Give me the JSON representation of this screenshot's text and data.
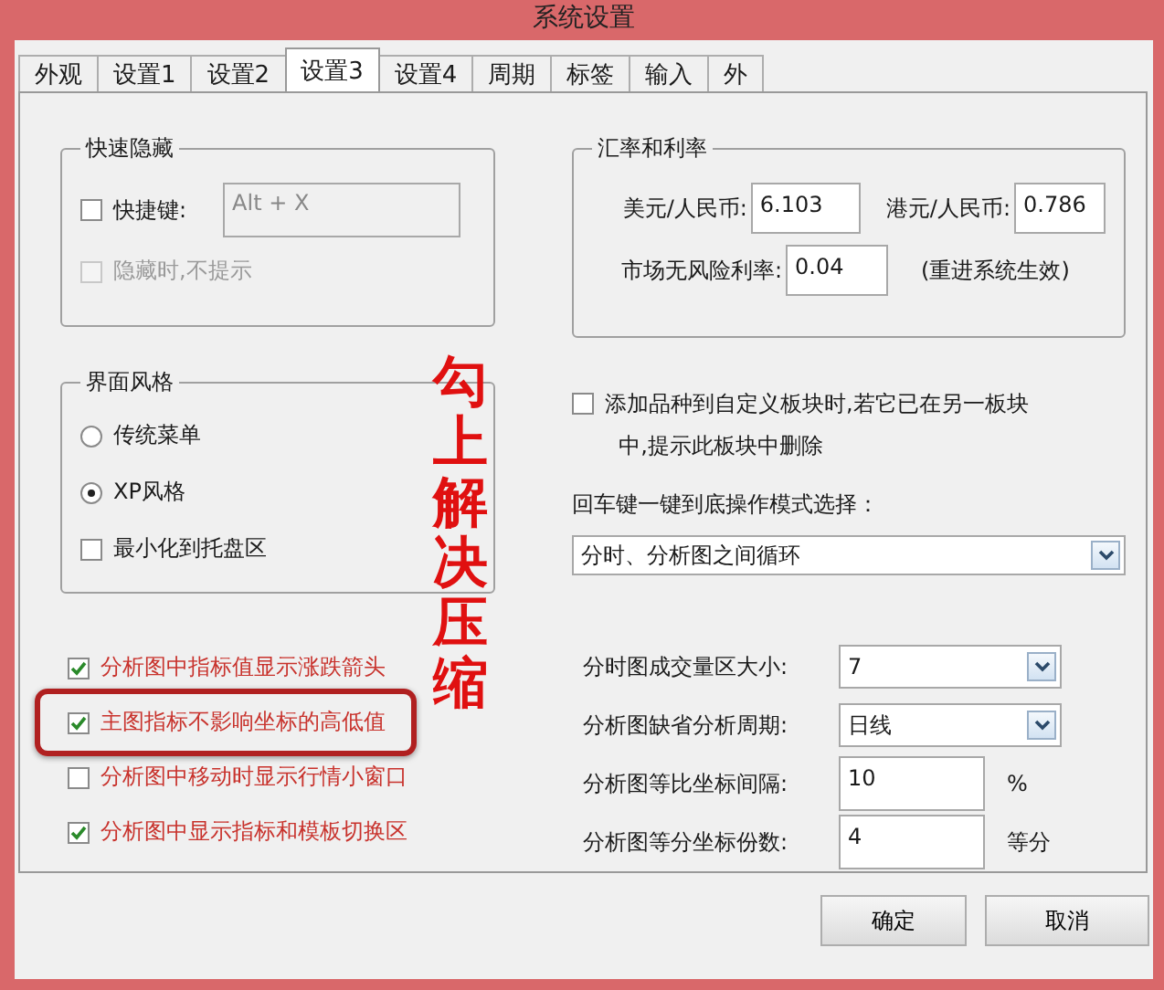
{
  "window": {
    "title": "系统设置"
  },
  "tabs": [
    {
      "label": "外观",
      "selected": false
    },
    {
      "label": "设置1",
      "selected": false
    },
    {
      "label": "设置2",
      "selected": false
    },
    {
      "label": "设置3",
      "selected": true
    },
    {
      "label": "设置4",
      "selected": false
    },
    {
      "label": "周期",
      "selected": false
    },
    {
      "label": "标签",
      "selected": false
    },
    {
      "label": "输入",
      "selected": false
    },
    {
      "label": "外",
      "selected": false
    }
  ],
  "quick_hide": {
    "title": "快速隐藏",
    "hotkey": {
      "label": "快捷键:",
      "checked": false,
      "value": "Alt + X"
    },
    "no_prompt": {
      "label": "隐藏时,不提示",
      "checked": false,
      "disabled": true
    }
  },
  "rates": {
    "title": "汇率和利率",
    "usd": {
      "label": "美元/人民币:",
      "value": "6.103"
    },
    "hkd": {
      "label": "港元/人民币:",
      "value": "0.786"
    },
    "risk_free": {
      "label": "市场无风险利率:",
      "value": "0.04",
      "note": "(重进系统生效)"
    }
  },
  "ui_style": {
    "title": "界面风格",
    "options": [
      {
        "label": "传统菜单",
        "selected": false
      },
      {
        "label": "XP风格",
        "selected": true
      }
    ],
    "minimize_to_tray": {
      "label": "最小化到托盘区",
      "checked": false
    }
  },
  "custom_block": {
    "lines": [
      "添加品种到自定义板块时,若它已在另一板块",
      "中,提示此板块中删除"
    ],
    "checked": false
  },
  "enter_mode": {
    "label": "回车键一键到底操作模式选择：",
    "value": "分时、分析图之间循环"
  },
  "chart_options": [
    {
      "label": "分析图中指标值显示涨跌箭头",
      "checked": true,
      "highlighted": false
    },
    {
      "label": "主图指标不影响坐标的高低值",
      "checked": true,
      "highlighted": true
    },
    {
      "label": "分析图中移动时显示行情小窗口",
      "checked": false,
      "highlighted": false
    },
    {
      "label": "分析图中显示指标和模板切换区",
      "checked": true,
      "highlighted": false
    }
  ],
  "chart_settings": [
    {
      "kind": "select",
      "label": "分时图成交量区大小:",
      "value": "7"
    },
    {
      "kind": "select",
      "label": "分析图缺省分析周期:",
      "value": "日线"
    },
    {
      "kind": "input",
      "label": "分析图等比坐标间隔:",
      "value": "10",
      "unit": "%"
    },
    {
      "kind": "input",
      "label": "分析图等分坐标份数:",
      "value": "4",
      "unit": "等分"
    }
  ],
  "annotation": {
    "text": "勾上解决压缩"
  },
  "buttons": [
    "确定",
    "取消"
  ]
}
